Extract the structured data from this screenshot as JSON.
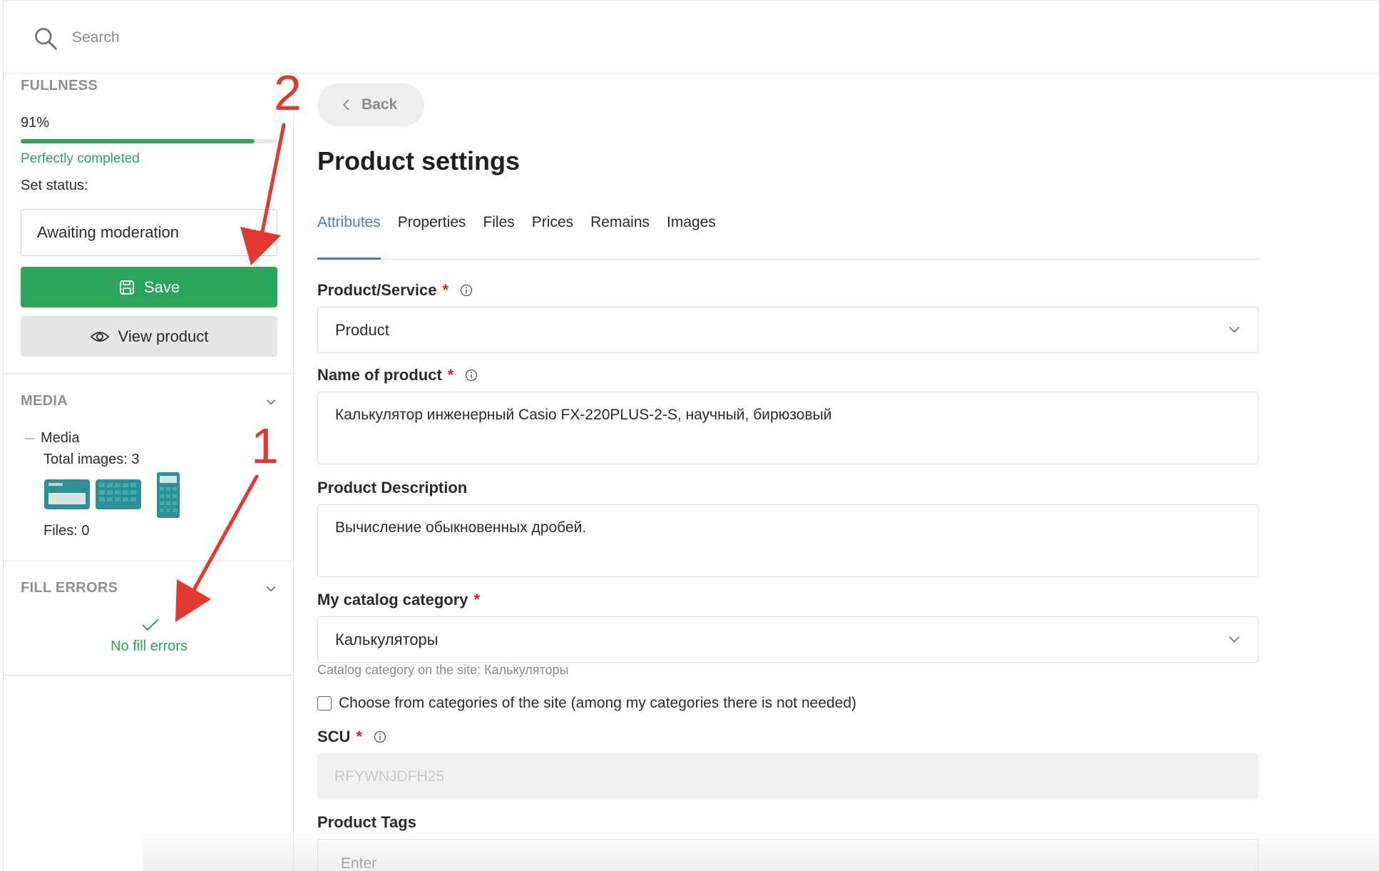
{
  "search": {
    "placeholder": "Search"
  },
  "sidebar": {
    "fullness": {
      "heading": "FULLNESS",
      "percent_text": "91%",
      "progress": 0.91,
      "status_text": "Perfectly completed",
      "set_status_label": "Set status:",
      "selected_status": "Awaiting moderation",
      "save_label": "Save",
      "view_label": "View product"
    },
    "media": {
      "heading": "MEDIA",
      "label": "Media",
      "total_images": "Total images: 3",
      "files": "Files: 0"
    },
    "fill_errors": {
      "heading": "FILL ERRORS",
      "message": "No fill errors"
    }
  },
  "main": {
    "back_label": "Back",
    "title": "Product settings",
    "tabs": [
      {
        "label": "Attributes",
        "active": true
      },
      {
        "label": "Properties",
        "active": false
      },
      {
        "label": "Files",
        "active": false
      },
      {
        "label": "Prices",
        "active": false
      },
      {
        "label": "Remains",
        "active": false
      },
      {
        "label": "Images",
        "active": false
      }
    ],
    "fields": {
      "product_service": {
        "label": "Product/Service",
        "value": "Product"
      },
      "name": {
        "label": "Name of product",
        "value": "Калькулятор инженерный Casio FX-220PLUS-2-S, научный, бирюзовый"
      },
      "description": {
        "label": "Product Description",
        "value": "Вычисление обыкновенных дробей."
      },
      "category": {
        "label": "My catalog category",
        "value": "Калькуляторы",
        "hint": "Catalog category on the site: Калькуляторы"
      },
      "site_categories_checkbox": "Choose from categories of the site (among my categories there is not needed)",
      "scu": {
        "label": "SCU",
        "value": "RFYWNJDFH25"
      },
      "tags": {
        "label": "Product Tags",
        "placeholder": "Enter"
      }
    },
    "required_mark": "*"
  },
  "annotations": {
    "one": "1",
    "two": "2"
  },
  "colors": {
    "accent_green": "#2aa55a",
    "tab_blue": "#3d7fd4",
    "required_red": "#e02020",
    "annotation_red": "#e23a30"
  }
}
